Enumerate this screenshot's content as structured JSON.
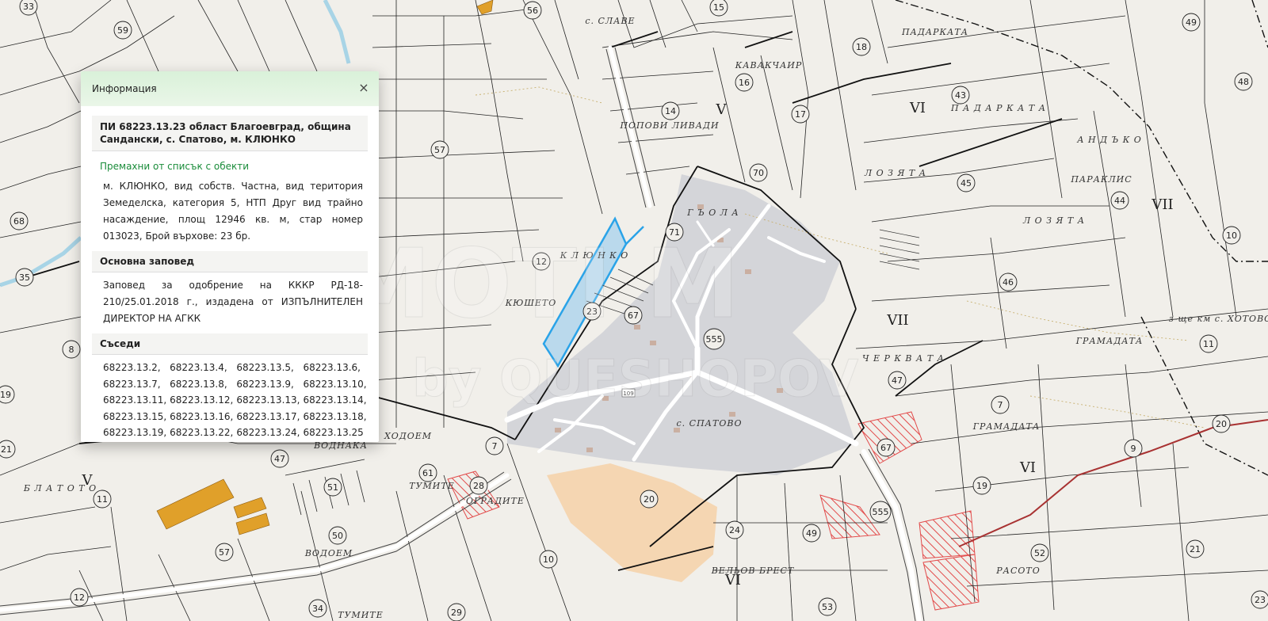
{
  "popup": {
    "header_title": "Информация",
    "close_icon": "×",
    "parcel_title": "ПИ 68223.13.23 област Благоевград, община Сандански, с. Спатово, м. КЛЮНКО",
    "remove_link": "Премахни от списък с обекти",
    "details": "м. КЛЮНКО, вид собств. Частна, вид територия Земеделска, категория 5, НТП Друг вид трайно насаждение, площ 12946 кв. м, стар номер 013023, Брой върхове: 23 бр.",
    "order_heading": "Основна заповед",
    "order_text": "Заповед за одобрение на КККР РД-18-210/25.01.2018 г., издадена от ИЗПЪЛНИТЕЛЕН ДИРЕКТОР НА АГКК",
    "neighbors_heading": "Съседи",
    "neighbors": [
      "68223.13.2,",
      "68223.13.4,",
      "68223.13.5,",
      "68223.13.6,",
      "68223.13.7,",
      "68223.13.8,",
      "68223.13.9,",
      "68223.13.10,",
      "68223.13.11,",
      "68223.13.12,",
      "68223.13.13,",
      "68223.13.14,",
      "68223.13.15,",
      "68223.13.16,",
      "68223.13.17,",
      "68223.13.18,",
      "68223.13.19,",
      "68223.13.22,",
      "68223.13.24,",
      "68223.13.25"
    ]
  },
  "map": {
    "place_names": [
      "с. СЛАВЕ",
      "ПАДАРКАТА",
      "КАВАКЧАИР",
      "ПОПОВИ ЛИВАДИ",
      "П А Д А Р К А Т А",
      "А Н Д Ъ К О",
      "ПАРАКЛИС",
      "Л О З Я Т А",
      "Л О З Я Т А",
      "Г Ъ О Л А",
      "К Л Ю Н К О",
      "КЮШЕТО",
      "Ч Е Р К В А Т А",
      "ГРАМАДАТА",
      "з-ще км с. ХОТОВО",
      "ГРАМАДАТА",
      "с. СПАТОВО",
      "ВОДНАКА",
      "ХОДОЕМ",
      "ТУМИТЕ",
      "ОГРАДИТЕ",
      "Б Л А Т О Т О",
      "ВОДОЕМ",
      "ВЕЛЬОВ БРЕСТ",
      "РАСОТО",
      "ТУМИТЕ"
    ],
    "roman_numerals": [
      "V",
      "VI",
      "VII",
      "VII",
      "VI",
      "V",
      "VI"
    ],
    "road_label": "109",
    "block_numbers": [
      "33",
      "59",
      "56",
      "15",
      "49",
      "48",
      "18",
      "43",
      "16",
      "14",
      "17",
      "57",
      "70",
      "45",
      "44",
      "10",
      "68",
      "12",
      "71",
      "46",
      "35",
      "23",
      "67",
      "555",
      "8",
      "47",
      "11",
      "19",
      "7",
      "20",
      "21",
      "7",
      "67",
      "47",
      "61",
      "28",
      "51",
      "11",
      "9",
      "19",
      "20",
      "555",
      "49",
      "24",
      "50",
      "57",
      "10",
      "52",
      "21",
      "12",
      "34",
      "29",
      "53",
      "23",
      "8"
    ]
  },
  "colors": {
    "map_background": "#f1efea",
    "parcel_outline": "#2aa3e8",
    "settlement_fill": "#cfd0d6",
    "orange_area": "#f5d3ac",
    "building_fill": "#e0a02a",
    "hatch": "#e24a4a",
    "header_gradient": "#d9f1d9",
    "link_green": "#1a8c3a"
  }
}
